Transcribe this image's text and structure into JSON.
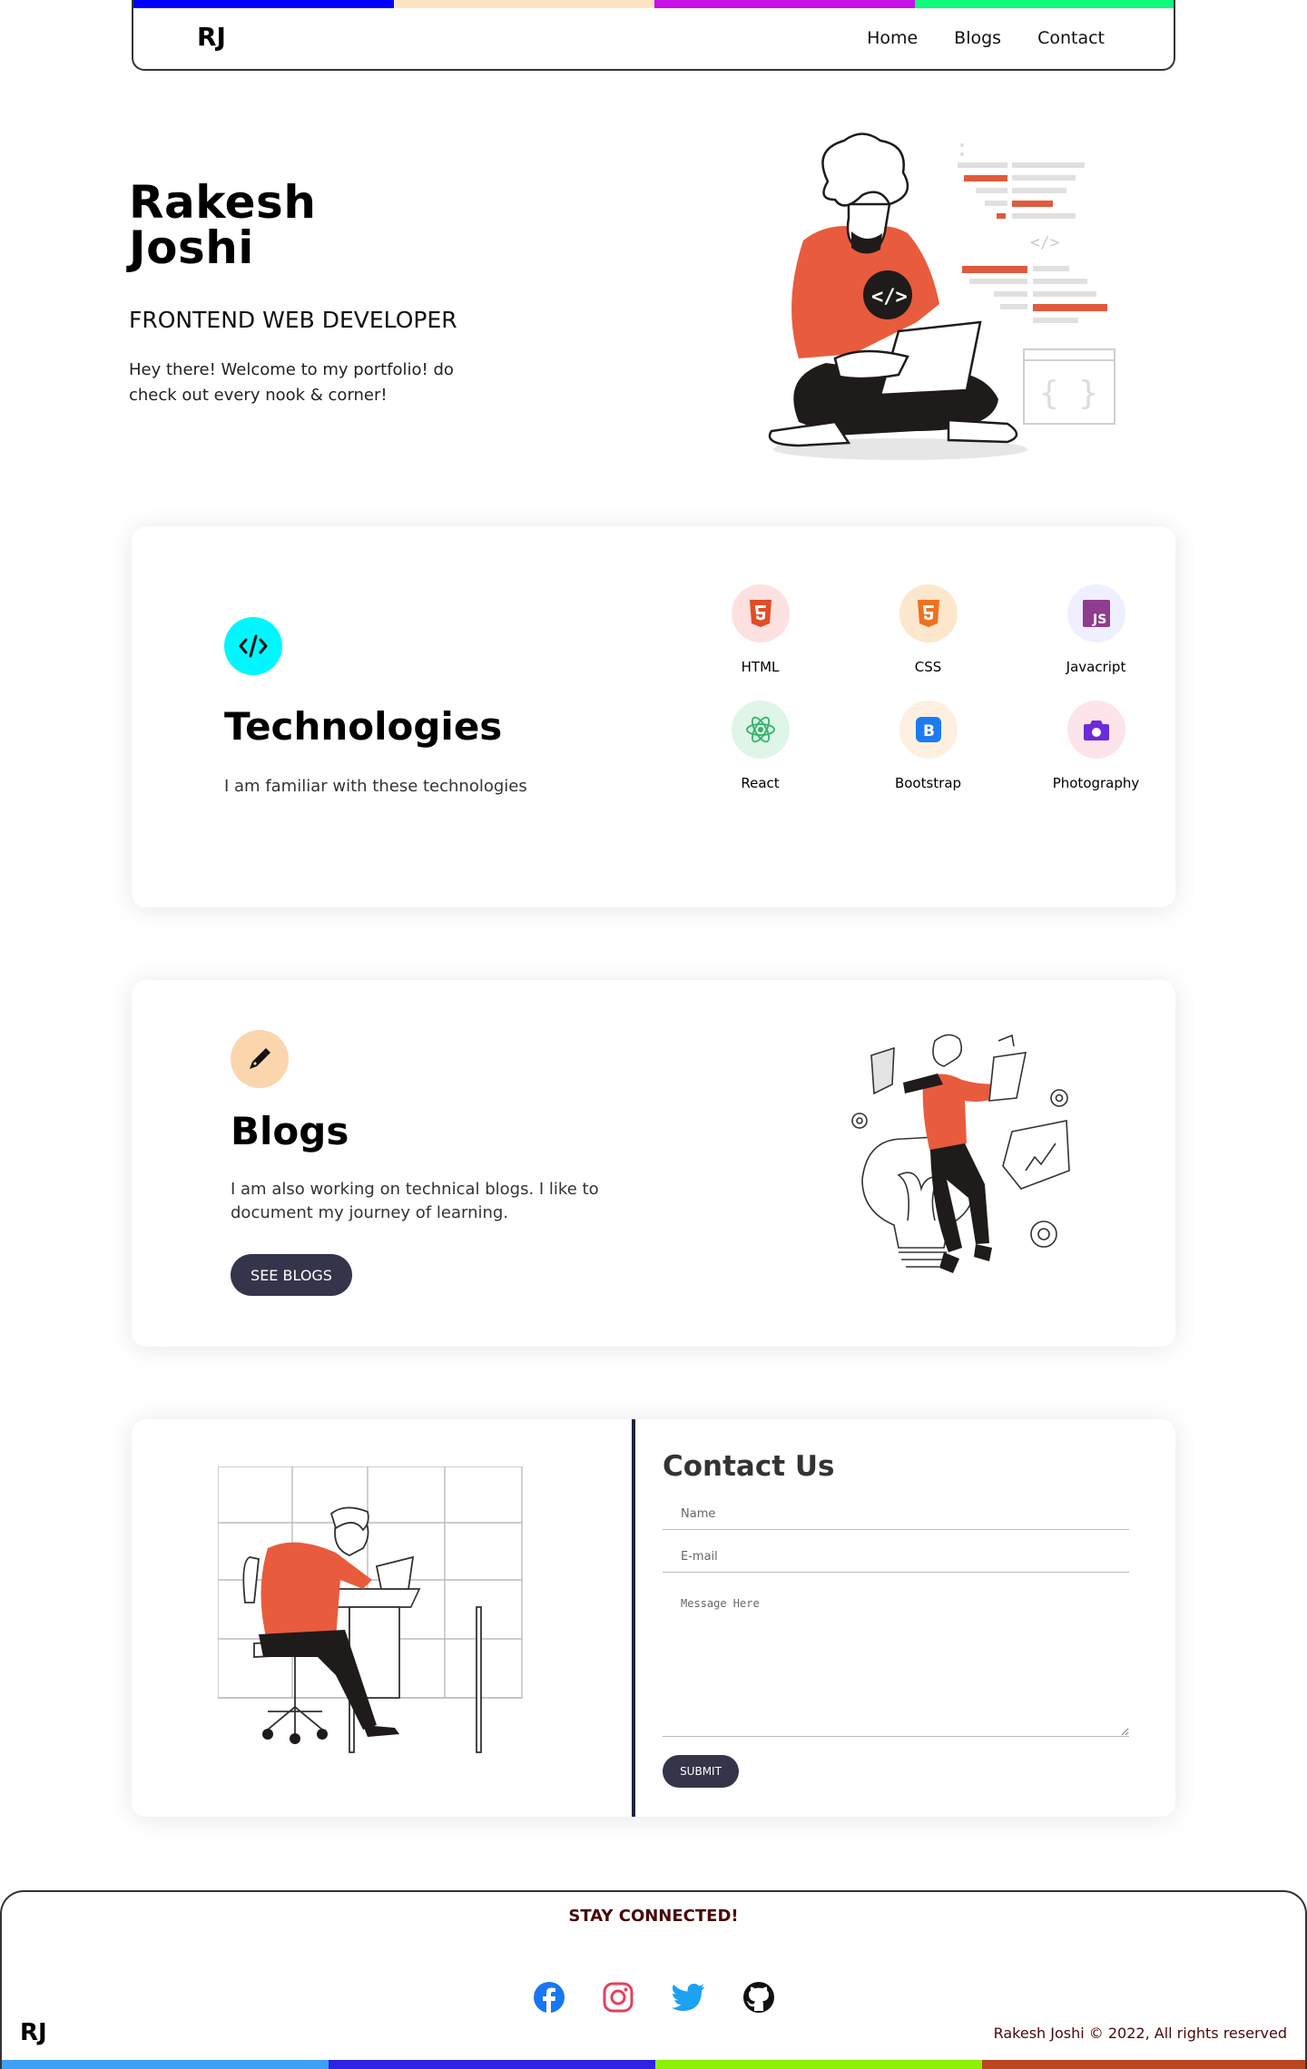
{
  "nav": {
    "logo": "RJ",
    "links": [
      {
        "label": "Home"
      },
      {
        "label": "Blogs"
      },
      {
        "label": "Contact"
      }
    ],
    "stripe_colors": [
      "#0000ff",
      "#fde4c3",
      "#c711e6",
      "#0dfa7c"
    ]
  },
  "hero": {
    "first_name": "Rakesh",
    "last_name": "Joshi",
    "role": "FRONTEND WEB DEVELOPER",
    "description": "Hey there! Welcome to my portfolio! do check out every nook & corner!"
  },
  "technologies": {
    "icon": "code-icon",
    "title": "Technologies",
    "subtitle": "I am familiar with these technologies",
    "items": [
      {
        "label": "HTML",
        "icon": "html5-icon",
        "bg": "#fde1e1"
      },
      {
        "label": "CSS",
        "icon": "css3-icon",
        "bg": "#fde7cc"
      },
      {
        "label": "Javacript",
        "icon": "javascript-icon",
        "bg": "#eef0ff"
      },
      {
        "label": "React",
        "icon": "react-icon",
        "bg": "#dff5e8"
      },
      {
        "label": "Bootstrap",
        "icon": "bootstrap-icon",
        "bg": "#fdf0e0"
      },
      {
        "label": "Photography",
        "icon": "camera-icon",
        "bg": "#fde4ea"
      }
    ]
  },
  "blogs": {
    "icon": "pen-icon",
    "title": "Blogs",
    "description": "I am also working on technical blogs. I like to document my journey of learning.",
    "button": "SEE BLOGS"
  },
  "contact": {
    "title": "Contact Us",
    "name_placeholder": "Name",
    "email_placeholder": "E-mail",
    "message_placeholder": "Message Here",
    "submit": "SUBMIT"
  },
  "footer": {
    "heading": "STAY CONNECTED!",
    "logo": "RJ",
    "copyright": "Rakesh Joshi © 2022, All rights reserved",
    "socials": [
      {
        "icon": "facebook-icon",
        "color": "#1877f2"
      },
      {
        "icon": "instagram-icon",
        "color": "#e4405f"
      },
      {
        "icon": "twitter-icon",
        "color": "#1da1f2"
      },
      {
        "icon": "github-icon",
        "color": "#111111"
      }
    ],
    "stripe_colors": [
      "#3ea0f5",
      "#2f22e0",
      "#8ef008",
      "#b8471f"
    ]
  }
}
